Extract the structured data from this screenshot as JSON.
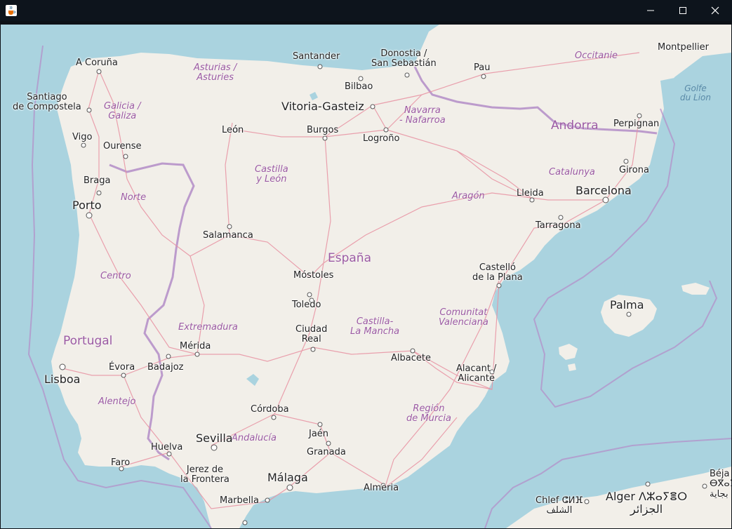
{
  "window": {
    "title": "",
    "icon": "java-cup-icon",
    "controls": [
      "minimize-icon",
      "maximize-icon",
      "close-icon"
    ]
  },
  "map": {
    "countries": {
      "spain": "España",
      "portugal": "Portugal",
      "andorra": "Andorra"
    },
    "regions": {
      "asturias": "Asturias /\nAsturies",
      "galicia": "Galicia /\nGaliza",
      "navarra": "Navarra\n- Nafarroa",
      "castilla_leon": "Castilla\ny León",
      "catalunya": "Catalunya",
      "aragon": "Aragón",
      "norte": "Norte",
      "centro": "Centro",
      "extremadura": "Extremadura",
      "castilla_mancha": "Castilla-\nLa Mancha",
      "comunitat": "Comunitat\nValenciana",
      "alentejo": "Alentejo",
      "murcia": "Región\nde Murcia",
      "andalucia": "Andalucía",
      "occitanie": "Occitanie"
    },
    "seas": {
      "golfe": "Golfe\ndu Lion"
    },
    "cities": {
      "coruna": "A Coruña",
      "santiago": "Santiago\nde Compostela",
      "vigo": "Vigo",
      "ourense": "Ourense",
      "braga": "Braga",
      "porto": "Porto",
      "santander": "Santander",
      "donostia": "Donostia /\nSan Sebastián",
      "pau": "Pau",
      "montpellier": "Montpellier",
      "bilbao": "Bilbao",
      "vitoria": "Vitoria-Gasteiz",
      "leon": "León",
      "burgos": "Burgos",
      "logrono": "Logroño",
      "perpignan": "Perpignan",
      "girona": "Girona",
      "lleida": "Lleida",
      "barcelona": "Barcelona",
      "tarragona": "Tarragona",
      "salamanca": "Salamanca",
      "mostoles": "Móstoles",
      "toledo": "Toledo",
      "castello": "Castelló\nde la Plana",
      "palma": "Palma",
      "ciudad_real": "Ciudad\nReal",
      "merida": "Mérida",
      "badajoz": "Badajoz",
      "evora": "Évora",
      "lisboa": "Lisboa",
      "albacete": "Albacete",
      "alacant": "Alacant /\nAlicante",
      "cordoba": "Córdoba",
      "jaen": "Jaén",
      "granada": "Granada",
      "sevilla": "Sevilla",
      "huelva": "Huelva",
      "faro": "Faro",
      "jerez": "Jerez de\nla Frontera",
      "malaga": "Málaga",
      "almeria": "Almeria",
      "marbella": "Marbella",
      "chlef": "Chlef ⵛⵍⴼ\nالشلف",
      "alger": "Alger ⴷⵣⴰⵢⴻⵔ\nالجزائر",
      "bejaia": "Béja\nⴱⴳⴰⵢ\nبجاية"
    },
    "colors": {
      "sea": "#aad3df",
      "land": "#f2efe9",
      "roads": "#e892a2",
      "border": "#b38cc7",
      "region_text": "#9b5aa3"
    }
  }
}
